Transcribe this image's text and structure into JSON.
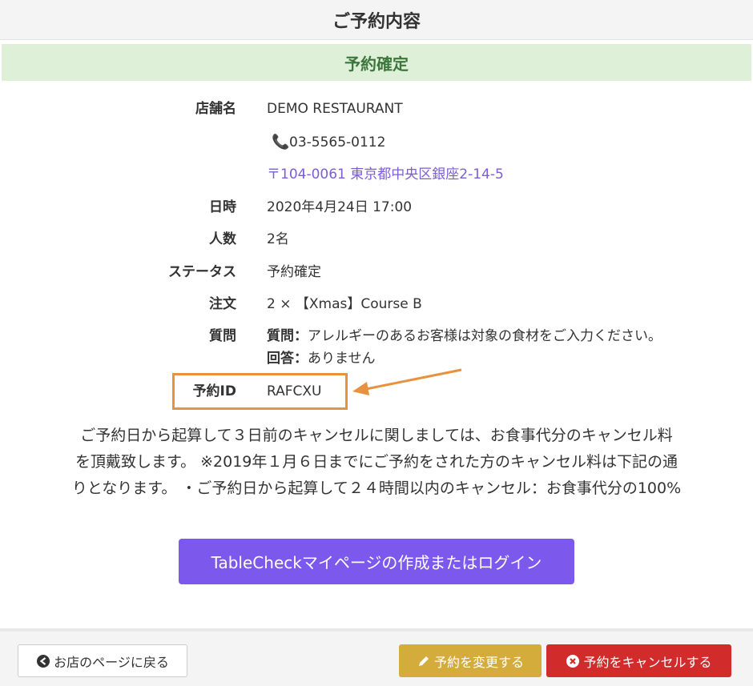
{
  "header": {
    "title": "ご予約内容"
  },
  "status_banner": {
    "text": "予約確定"
  },
  "details": {
    "store_label": "店舗名",
    "store_name": "DEMO RESTAURANT",
    "phone": "03-5565-0112",
    "address": "〒104-0061 東京都中央区銀座2-14-5",
    "datetime_label": "日時",
    "datetime": "2020年4月24日 17:00",
    "people_label": "人数",
    "people": "2名",
    "status_label": "ステータス",
    "status": "予約確定",
    "order_label": "注文",
    "order": "2 × 【Xmas】Course B",
    "question_label": "質問",
    "question_key": "質問：",
    "question_text": "アレルギーのあるお客様は対象の食材をご入力ください。",
    "answer_key": "回答：",
    "answer_text": "ありません",
    "reservation_id_label": "予約ID",
    "reservation_id": "RAFCXU"
  },
  "policy": {
    "line1": "ご予約日から起算して３日前のキャンセルに関しましては、お食事代分のキャンセル料",
    "line2": "を頂戴致します。 ※2019年１月６日までにご予約をされた方のキャンセル料は下記の通",
    "line3": "りとなります。 ・ご予約日から起算して２４時間以内のキャンセル：お食事代分の100%"
  },
  "tablecheck_button": {
    "label": "TableCheckマイページの作成またはログイン"
  },
  "footer": {
    "back_label": "お店のページに戻る",
    "change_label": "予約を変更する",
    "cancel_label": "予約をキャンセルする"
  },
  "colors": {
    "accent_purple": "#7c58ec",
    "link_purple": "#7b5cd9",
    "confirmed_green": "#3c763d",
    "confirmed_bg": "#dff0d8",
    "highlight_orange": "#e8913e",
    "change_yellow": "#d3ac3c",
    "cancel_red": "#d12b2b"
  },
  "icons": {
    "phone": "phone-icon",
    "back": "arrow-left-circle-icon",
    "change": "pencil-icon",
    "cancel": "x-circle-icon"
  }
}
